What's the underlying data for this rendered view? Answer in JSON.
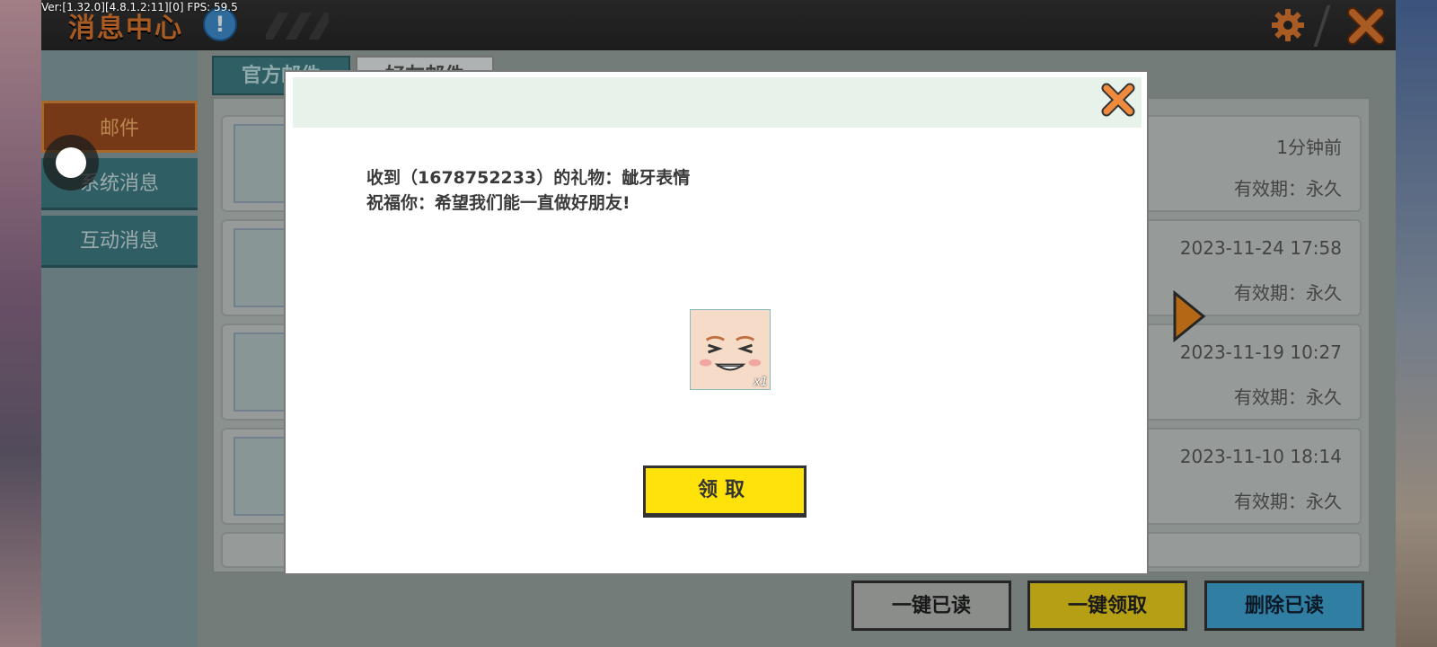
{
  "debug": {
    "version_text": "Ver:[1.32.0][4.8.1.2:11][0] FPS: 59.5"
  },
  "header": {
    "title": "消息中心"
  },
  "sidebar": {
    "items": [
      {
        "label": "邮件",
        "active": true
      },
      {
        "label": "系统消息",
        "active": false
      },
      {
        "label": "互动消息",
        "active": false
      }
    ]
  },
  "tabs": [
    {
      "label": "官方邮件",
      "active": true
    },
    {
      "label": "好友邮件",
      "active": false
    }
  ],
  "mail_list": [
    {
      "time": "1分钟前",
      "validity": "有效期：永久"
    },
    {
      "time": "2023-11-24 17:58",
      "validity": "有效期：永久"
    },
    {
      "time": "2023-11-19 10:27",
      "validity": "有效期：永久"
    },
    {
      "time": "2023-11-10 18:14",
      "validity": "有效期：永久"
    }
  ],
  "actions": {
    "mark_all_read": "一键已读",
    "collect_all": "一键领取",
    "delete_read": "删除已读"
  },
  "modal": {
    "line1": "收到（1678752233）的礼物：龇牙表情",
    "line2": "祝福你：希望我们能一直做好朋友!",
    "gift_count": "x1",
    "claim_label": "领取"
  },
  "colors": {
    "accent_orange": "#e07a2e",
    "claim_yellow": "#ffe20a",
    "teal": "#3f7f86",
    "delete_blue": "#41a9d8"
  }
}
